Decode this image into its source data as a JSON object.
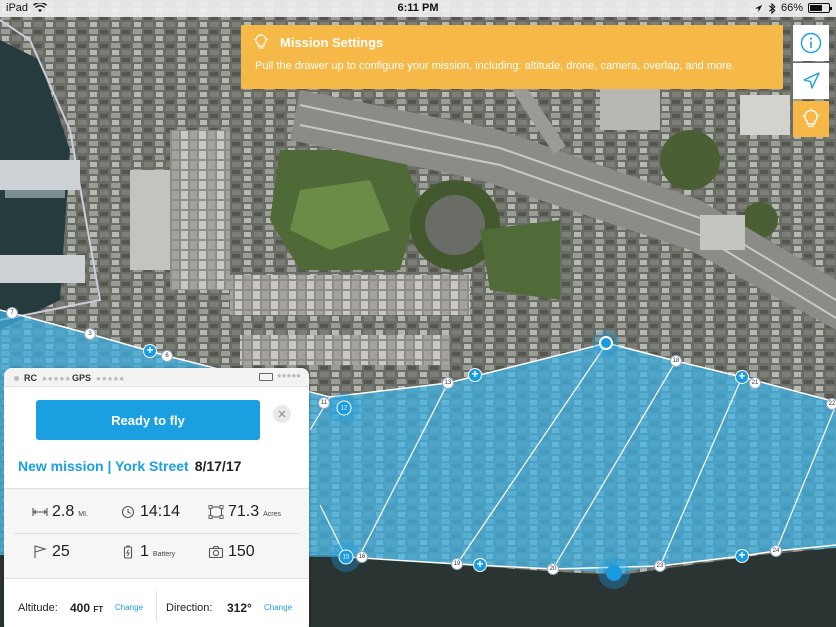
{
  "status_bar": {
    "device": "iPad",
    "time": "6:11 PM",
    "battery": "66%",
    "battery_level": 0.66
  },
  "tip": {
    "title": "Mission Settings",
    "body": "Pull the drawer up to configure your mission, including: altitude, drone, camera, overlap, and more."
  },
  "side_buttons": {
    "info": "info-icon",
    "locate": "location-arrow-icon",
    "tips": "lightbulb-icon"
  },
  "panel": {
    "rc_label": "RC",
    "gps_label": "GPS",
    "ready_button": "Ready to fly",
    "mission_name": "New mission | York Street",
    "mission_date": "8/17/17",
    "stats": {
      "distance_value": "2.8",
      "distance_unit": "MI.",
      "time_value": "14:14",
      "area_value": "71.3",
      "area_unit": "Acres",
      "waypoints_value": "25",
      "battery_value": "1",
      "battery_unit": "Battery",
      "photos_value": "150"
    },
    "altitude_label": "Altitude:",
    "altitude_value": "400",
    "altitude_unit": "FT",
    "altitude_change": "Change",
    "direction_label": "Direction:",
    "direction_value": "312°",
    "direction_change": "Change"
  },
  "map": {
    "waypoints": [
      "7",
      "3",
      "6",
      "11",
      "12",
      "13",
      "18",
      "21",
      "22",
      "15",
      "16",
      "19",
      "20",
      "23",
      "24"
    ],
    "colors": {
      "flight_area": "#3fb6e8",
      "accent": "#1aa0e0",
      "tip": "#f6b847"
    }
  }
}
